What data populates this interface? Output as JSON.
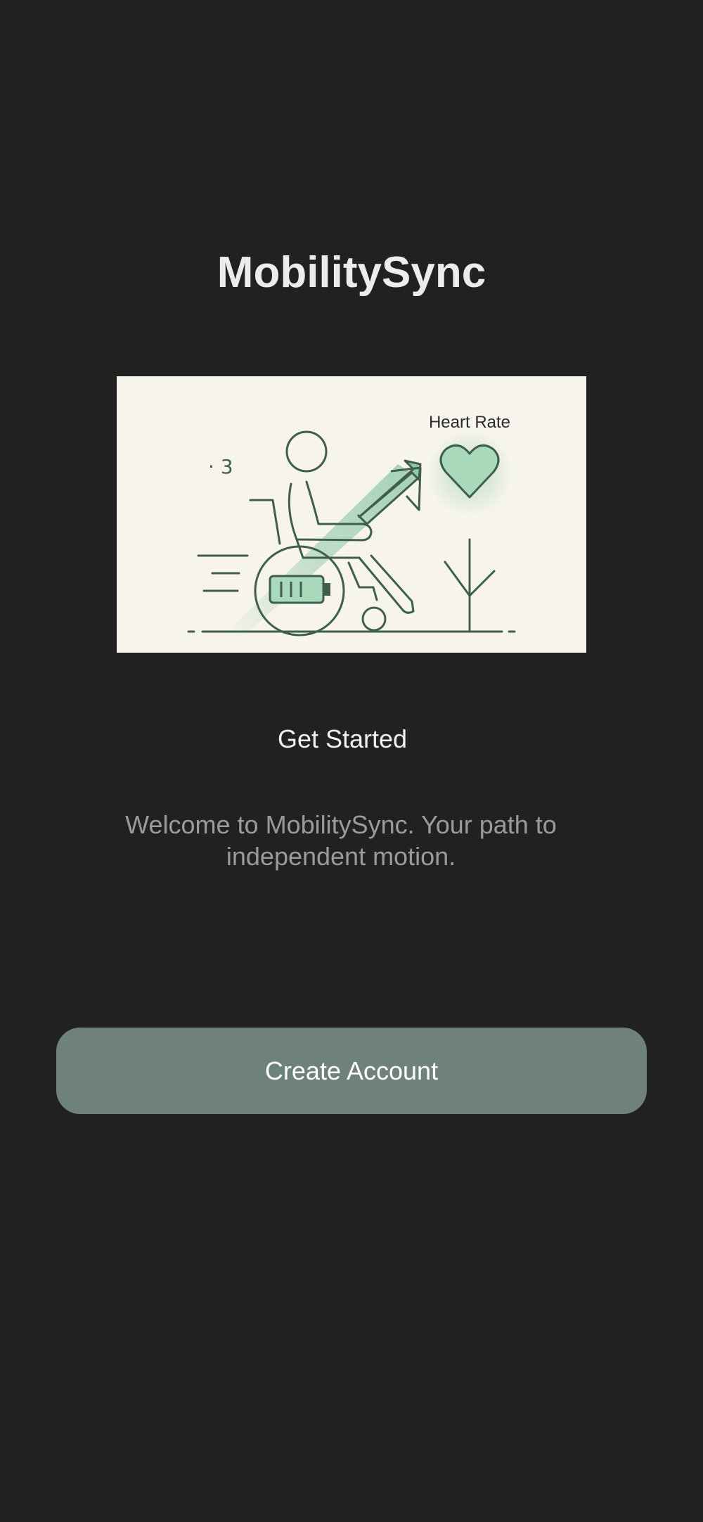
{
  "app": {
    "title": "MobilitySync"
  },
  "hero": {
    "illustration": "wheelchair-user-with-upward-arrow-battery-heart-icon",
    "heart_label": "Heart Rate",
    "doodle_text": "· 3",
    "colors": {
      "background": "#f7f4ee",
      "stroke": "#3f5f4c",
      "accent": "#8fc9a6"
    }
  },
  "onboarding": {
    "heading": "Get Started",
    "welcome_text": "Welcome to MobilitySync. Your path to independent motion."
  },
  "actions": {
    "create_account_label": "Create Account"
  },
  "theme": {
    "background": "#212121",
    "button": "#6f8279",
    "title_text": "#ececec",
    "muted_text": "#9b9b9b"
  }
}
